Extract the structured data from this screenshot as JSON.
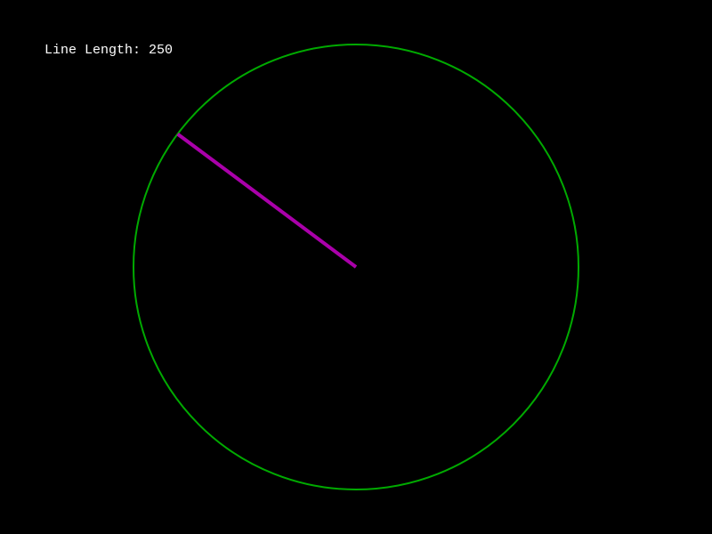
{
  "readout": {
    "label": "Line Length:",
    "value": 250
  },
  "circle": {
    "radius": 250,
    "color": "#00aa00"
  },
  "line": {
    "length": 250,
    "angle_degrees": 143.3,
    "color": "#aa00aa"
  },
  "background_color": "#000000"
}
